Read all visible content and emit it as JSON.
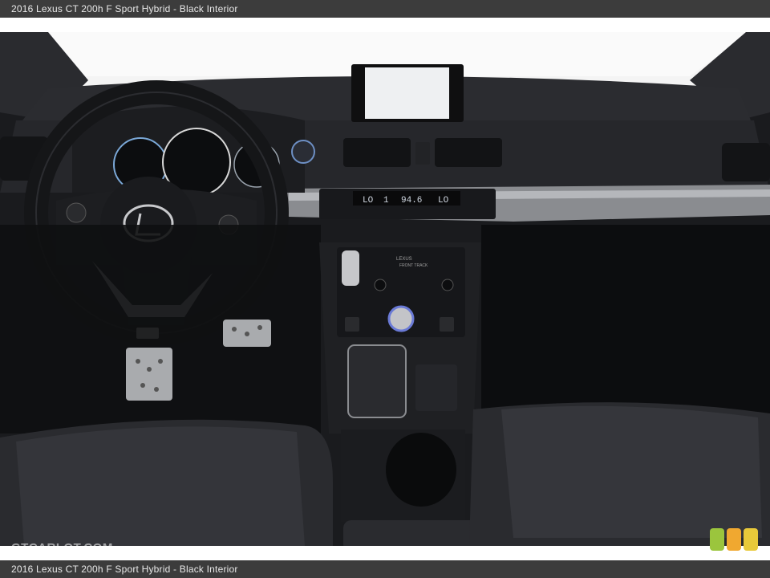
{
  "header": {
    "title": "2016 Lexus CT 200h F Sport Hybrid - Black Interior"
  },
  "footer": {
    "caption": "2016 Lexus CT 200h F Sport Hybrid - Black Interior"
  },
  "watermark": {
    "text": "GTCARLOT.COM"
  },
  "climate_display": {
    "left_temp": "LO",
    "fan": "1",
    "radio": "94.6",
    "right_temp": "LO"
  },
  "console_labels": {
    "brand": "LEXUS",
    "drive_mode": "FRONT TRACK"
  },
  "colors": {
    "bar_bg": "#3c3c3c",
    "cabin_dark": "#1a1b1e",
    "badge_green": "#9bc53d",
    "badge_orange": "#f0a830",
    "badge_yellow": "#e8c93a"
  }
}
